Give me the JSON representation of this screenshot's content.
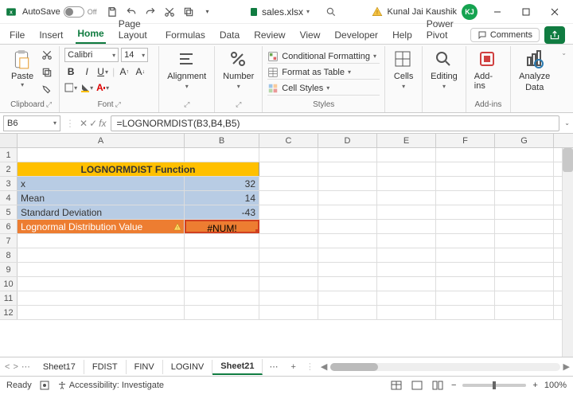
{
  "titlebar": {
    "autosave_label": "AutoSave",
    "autosave_state": "Off",
    "filename": "sales.xlsx",
    "user_name": "Kunal Jai Kaushik",
    "user_initials": "KJ"
  },
  "menu_tabs": [
    "File",
    "Insert",
    "Home",
    "Page Layout",
    "Formulas",
    "Data",
    "Review",
    "View",
    "Developer",
    "Help",
    "Power Pivot"
  ],
  "active_menu_tab": "Home",
  "comments_label": "Comments",
  "ribbon": {
    "clipboard": {
      "paste": "Paste",
      "group": "Clipboard"
    },
    "font": {
      "name": "Calibri",
      "size": "14",
      "group": "Font"
    },
    "alignment": {
      "label": "Alignment"
    },
    "number": {
      "label": "Number"
    },
    "styles": {
      "cond": "Conditional Formatting",
      "table": "Format as Table",
      "cell": "Cell Styles",
      "group": "Styles"
    },
    "cells": {
      "label": "Cells"
    },
    "editing": {
      "label": "Editing"
    },
    "addins": {
      "btn": "Add-ins",
      "group": "Add-ins"
    },
    "analyze": {
      "line1": "Analyze",
      "line2": "Data"
    }
  },
  "namebox": "B6",
  "formula": "=LOGNORMDIST(B3,B4,B5)",
  "columns": [
    "A",
    "B",
    "C",
    "D",
    "E",
    "F",
    "G"
  ],
  "row_numbers": [
    "1",
    "2",
    "3",
    "4",
    "5",
    "6",
    "7",
    "8",
    "9",
    "10",
    "11",
    "12"
  ],
  "cells": {
    "header": "LOGNORMDIST Function",
    "r3a": "x",
    "r3b": "32",
    "r4a": "Mean",
    "r4b": "14",
    "r5a": "Standard Deviation",
    "r5b": "-43",
    "r6a": "Lognormal Distribution Value",
    "r6b": "#NUM!"
  },
  "sheet_tabs": [
    "Sheet17",
    "FDIST",
    "FINV",
    "LOGINV",
    "Sheet21"
  ],
  "active_sheet_tab": "Sheet21",
  "statusbar": {
    "ready": "Ready",
    "access": "Accessibility: Investigate",
    "zoom": "100%"
  }
}
